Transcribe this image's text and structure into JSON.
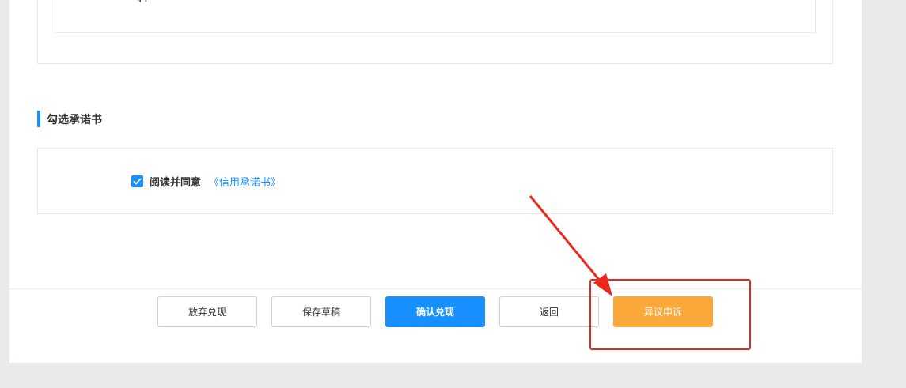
{
  "upper_section": {
    "cut_text": "料"
  },
  "commitment_section": {
    "title": "勾选承诺书",
    "agree_label": "阅读并同意",
    "agree_link": "《信用承诺书》",
    "agree_checked": true
  },
  "footer": {
    "buttons": {
      "abandon": "放弃兑现",
      "save_draft": "保存草稿",
      "confirm": "确认兑现",
      "back": "返回",
      "appeal": "异议申诉"
    }
  },
  "colors": {
    "primary": "#1890ff",
    "appeal": "#fba83b",
    "annotation": "#e8291c"
  }
}
